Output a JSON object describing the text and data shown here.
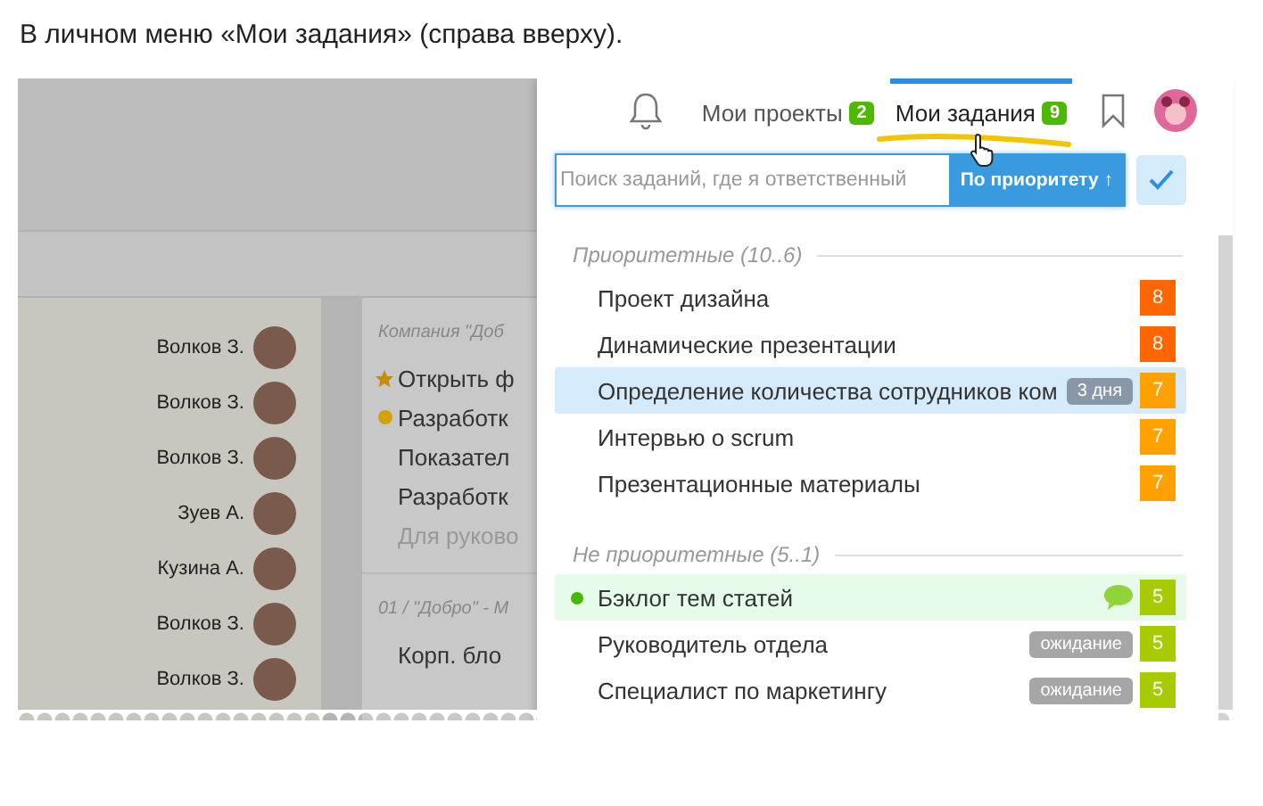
{
  "caption": "В личном меню «Мои задания» (справа вверху).",
  "background": {
    "people": [
      {
        "name": "Волков З."
      },
      {
        "name": "Волков З."
      },
      {
        "name": "Волков З."
      },
      {
        "name": "Зуев А."
      },
      {
        "name": "Кузина А."
      },
      {
        "name": "Волков З."
      },
      {
        "name": "Волков З."
      }
    ],
    "sections": [
      {
        "title": "Компания \"Доб",
        "items": [
          {
            "text": "Открыть ф",
            "kind": "star",
            "muted": false
          },
          {
            "text": "Разработк",
            "kind": "dot",
            "muted": false
          },
          {
            "text": "Показател",
            "kind": "plain",
            "muted": false
          },
          {
            "text": "Разработк",
            "kind": "plain",
            "muted": false
          },
          {
            "text": "Для руково",
            "kind": "plain",
            "muted": true
          }
        ]
      },
      {
        "title": "01 / \"Добро\" - М",
        "items": [
          {
            "text": "Корп. бло",
            "kind": "plain",
            "muted": false
          }
        ]
      }
    ]
  },
  "popup": {
    "tabs": [
      {
        "label": "Мои проекты",
        "count": "2",
        "selected": false
      },
      {
        "label": "Мои задания",
        "count": "9",
        "selected": true
      }
    ],
    "search": {
      "placeholder": "Поиск заданий, где я ответственный"
    },
    "sort_button": "По приоритету ↑",
    "groups": [
      {
        "title": "Приоритетные (10..6)",
        "tasks": [
          {
            "title": "Проект дизайна",
            "score": "8",
            "color": "#ff6600",
            "selected": false,
            "unread": false,
            "has_comment": false
          },
          {
            "title": "Динамические презентации",
            "score": "8",
            "color": "#ff6600",
            "selected": false,
            "unread": false,
            "has_comment": false
          },
          {
            "title": "Определение количества сотрудников ком",
            "badge": {
              "text": "3 дня",
              "color": "#8a97a8"
            },
            "score": "7",
            "color": "#ffa200",
            "selected": true,
            "unread": false,
            "has_comment": false
          },
          {
            "title": "Интервью о scrum",
            "score": "7",
            "color": "#ffa200",
            "selected": false,
            "unread": false,
            "has_comment": false
          },
          {
            "title": "Презентационные материалы",
            "score": "7",
            "color": "#ffa200",
            "selected": false,
            "unread": false,
            "has_comment": false
          }
        ]
      },
      {
        "title": "Не приоритетные (5..1)",
        "tasks": [
          {
            "title": "Бэклог тем статей",
            "score": "5",
            "color": "#a6cc00",
            "selected": false,
            "unread": true,
            "has_comment": true
          },
          {
            "title": "Руководитель отдела",
            "badge": {
              "text": "ожидание",
              "color": "#a6a6a6"
            },
            "score": "5",
            "color": "#a6cc00",
            "selected": false,
            "unread": false,
            "has_comment": false
          },
          {
            "title": "Специалист по маркетингу",
            "badge": {
              "text": "ожидание",
              "color": "#a6a6a6"
            },
            "score": "5",
            "color": "#a6cc00",
            "selected": false,
            "unread": false,
            "has_comment": false
          }
        ]
      }
    ]
  }
}
